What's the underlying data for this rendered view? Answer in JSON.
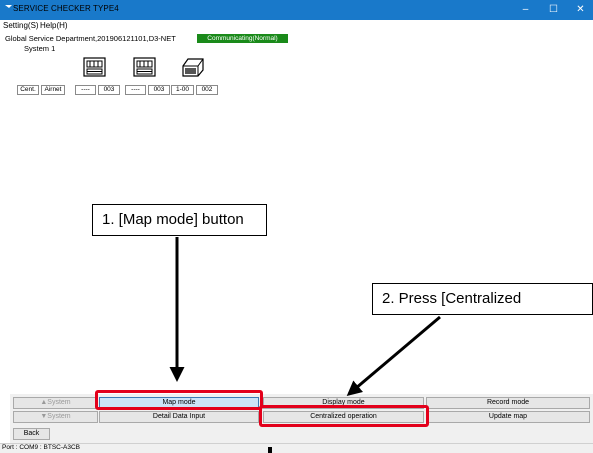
{
  "window": {
    "title": "SERVICE CHECKER TYPE4",
    "controls": {
      "minimize": "–",
      "maximize": "☐",
      "close": "✕"
    }
  },
  "menu": {
    "setting": "Setting(S)",
    "help": "Help(H)"
  },
  "status": {
    "department": "Global Service Department,201906121101,D3-NET",
    "communication": "Communicating(Normal)",
    "communication_color": "#1a8a1a"
  },
  "system": {
    "label": "System 1",
    "units": [
      {
        "icon": "indoor-unit-icon"
      },
      {
        "icon": "indoor-unit-icon"
      },
      {
        "icon": "outdoor-unit-icon"
      }
    ],
    "tabs": [
      "Cent.",
      "Airnet"
    ],
    "addresses": [
      "----",
      "003",
      "----",
      "003",
      "1-00",
      "002"
    ]
  },
  "controls": {
    "system_up": "▲System",
    "system_down": "▼System",
    "map_mode": "Map mode",
    "display_mode": "Display mode",
    "record_mode": "Record mode",
    "detail_input": "Detail Data Input",
    "centralized": "Centralized operation",
    "update_map": "Update map",
    "back": "Back"
  },
  "statusbar": {
    "port": "Port : COM9 : BTSC-A3CB"
  },
  "annotations": {
    "step1": "1. [Map mode] button",
    "step2": "2. Press [Centralized",
    "highlight_color": "#e3001b"
  }
}
